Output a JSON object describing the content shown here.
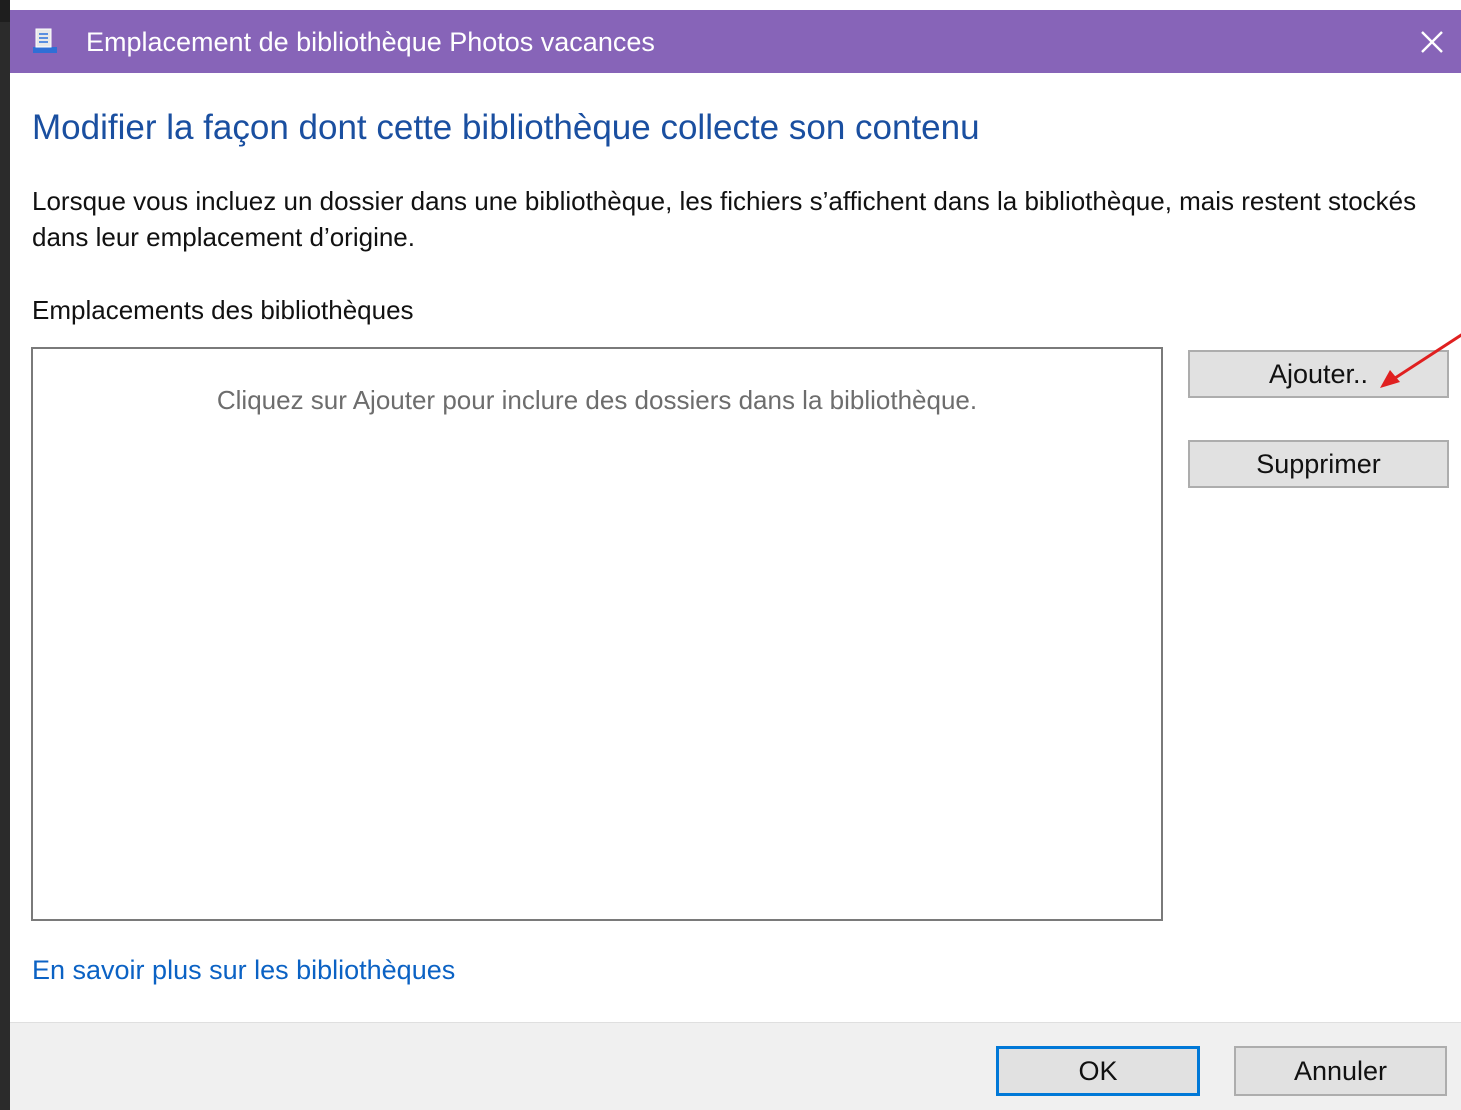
{
  "window": {
    "title": "Emplacement de bibliothèque Photos vacances",
    "accent_color": "#8764b8"
  },
  "content": {
    "heading": "Modifier la façon dont cette bibliothèque collecte son contenu",
    "description": "Lorsque vous incluez un dossier dans une bibliothèque, les fichiers s’affichent dans la bibliothèque, mais restent stockés dans leur emplacement d’origine.",
    "locations_label": "Emplacements des bibliothèques",
    "empty_hint": "Cliquez sur Ajouter pour inclure des dossiers dans la bibliothèque.",
    "learn_more_link": "En savoir plus sur les bibliothèques"
  },
  "buttons": {
    "add": "Ajouter..",
    "remove": "Supprimer",
    "ok": "OK",
    "cancel": "Annuler"
  },
  "icons": {
    "title_icon": "library-icon",
    "close_icon": "close-icon",
    "annotation": "red-arrow-annotation"
  }
}
